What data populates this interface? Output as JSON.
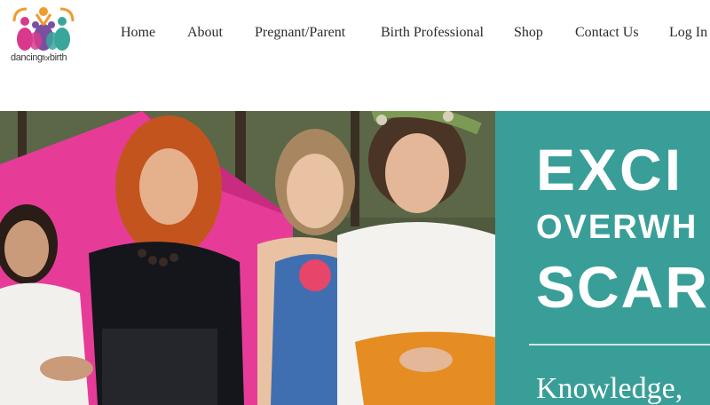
{
  "logo": {
    "wordmark_main": "dancing",
    "wordmark_small": "for",
    "wordmark_end": "birth"
  },
  "nav": {
    "items": [
      {
        "label": "Home"
      },
      {
        "label": "About"
      },
      {
        "label": "Pregnant/Parent"
      },
      {
        "label": "Birth Professional"
      },
      {
        "label": "Shop"
      },
      {
        "label": "Contact Us"
      },
      {
        "label": "Log In"
      }
    ]
  },
  "hero": {
    "headline_1": "EXCI",
    "headline_2": "OVERWH",
    "headline_3": "SCAR",
    "subline": "Knowledge,"
  },
  "colors": {
    "panel": "#3a9e98",
    "tent": "#e63c98",
    "logo_pink": "#d9398c",
    "logo_purple": "#7b4fa0",
    "logo_teal": "#3aa69a",
    "logo_orange": "#f29a2e"
  }
}
